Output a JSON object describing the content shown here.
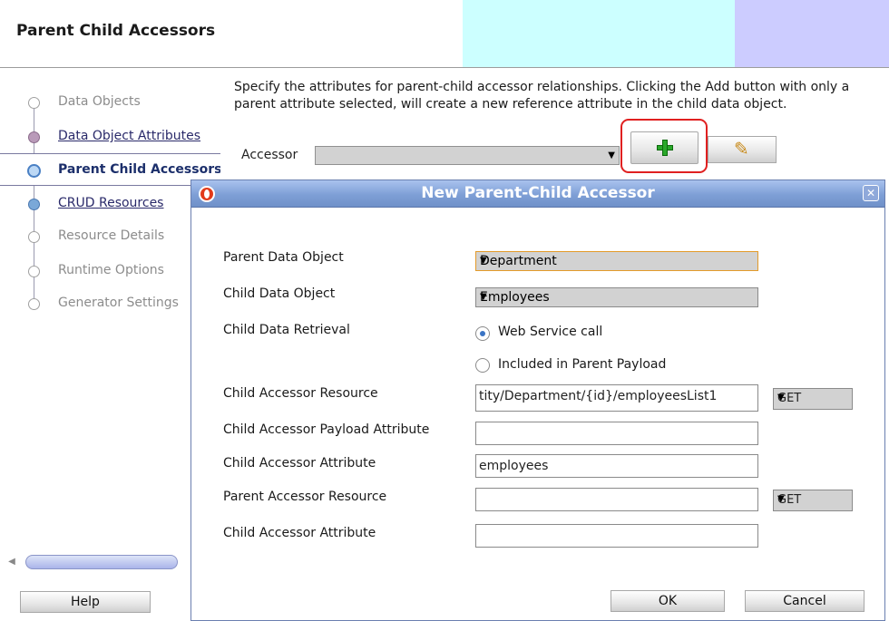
{
  "header": {
    "title": "Parent Child Accessors"
  },
  "nav": {
    "items": [
      {
        "label": "Data Objects",
        "state": "future"
      },
      {
        "label": "Data Object Attributes",
        "state": "visited"
      },
      {
        "label": "Parent Child Accessors",
        "state": "current"
      },
      {
        "label": "CRUD Resources",
        "state": "next"
      },
      {
        "label": "Resource Details",
        "state": "future"
      },
      {
        "label": "Runtime Options",
        "state": "future"
      },
      {
        "label": "Generator Settings",
        "state": "future"
      }
    ]
  },
  "help_label": "Help",
  "main": {
    "instructions": "Specify the attributes for parent-child accessor relationships. Clicking the Add button with only a parent attribute selected, will create a new reference attribute in the child data object.",
    "accessor_label": "Accessor",
    "accessor_value": "",
    "add_icon": "plus-icon",
    "edit_icon": "pencil-icon"
  },
  "dialog": {
    "title": "New Parent-Child Accessor",
    "fields": {
      "parent_data_object_label": "Parent Data Object",
      "parent_data_object_value": "Department",
      "child_data_object_label": "Child Data Object",
      "child_data_object_value": "Employees",
      "child_data_retrieval_label": "Child Data Retrieval",
      "retrieval_option_1": "Web Service call",
      "retrieval_option_2": "Included in Parent Payload",
      "retrieval_selected": "Web Service call",
      "child_accessor_resource_label": "Child Accessor Resource",
      "child_accessor_resource_value": "tity/Department/{id}/employeesList1",
      "child_accessor_resource_method": "GET",
      "child_accessor_payload_attribute_label": "Child Accessor Payload Attribute",
      "child_accessor_payload_attribute_value": "",
      "child_accessor_attribute_label": "Child Accessor Attribute",
      "child_accessor_attribute_value": "employees",
      "parent_accessor_resource_label": "Parent Accessor Resource",
      "parent_accessor_resource_value": "",
      "parent_accessor_resource_method": "GET",
      "child_accessor_attribute_2_label": "Child Accessor Attribute",
      "child_accessor_attribute_2_value": ""
    },
    "ok_label": "OK",
    "cancel_label": "Cancel"
  },
  "colors": {
    "header_cyan": "#ccffff",
    "header_lavender": "#ccccff",
    "dialog_title_bar": "#7e9fd6",
    "highlight_red": "#e02020"
  }
}
